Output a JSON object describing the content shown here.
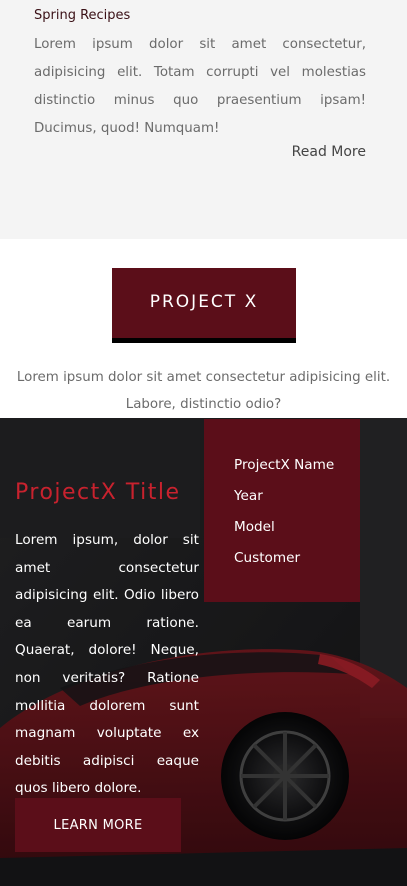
{
  "recipe": {
    "title": "Spring Recipes",
    "body": "Lorem ipsum dolor sit amet consectetur, adipisicing elit. Totam corrupti vel molestias distinctio minus quo praesentium ipsam! Ducimus, quod! Numquam!",
    "read_more": "Read More"
  },
  "project": {
    "header_label": "PROJECT X",
    "lead": "Lorem ipsum dolor sit amet consectetur adipisicing elit. Labore, distinctio odio?"
  },
  "hero": {
    "title": "ProjectX Title",
    "body": "Lorem ipsum, dolor sit amet consectetur adipisicing elit. Odio libero ea earum ratione. Quaerat, dolore! Neque, non veritatis? Ratione mollitia dolorem sunt magnam voluptate ex debitis adipisci eaque quos libero dolore.",
    "button_label": "LEARN MORE",
    "info_items": [
      "ProjectX Name",
      "Year",
      "Model",
      "Customer"
    ]
  },
  "colors": {
    "accent": "#5b0e19",
    "title_red": "#c8222e",
    "dark_bg": "#1f1f21",
    "light_bg": "#f4f4f4"
  }
}
